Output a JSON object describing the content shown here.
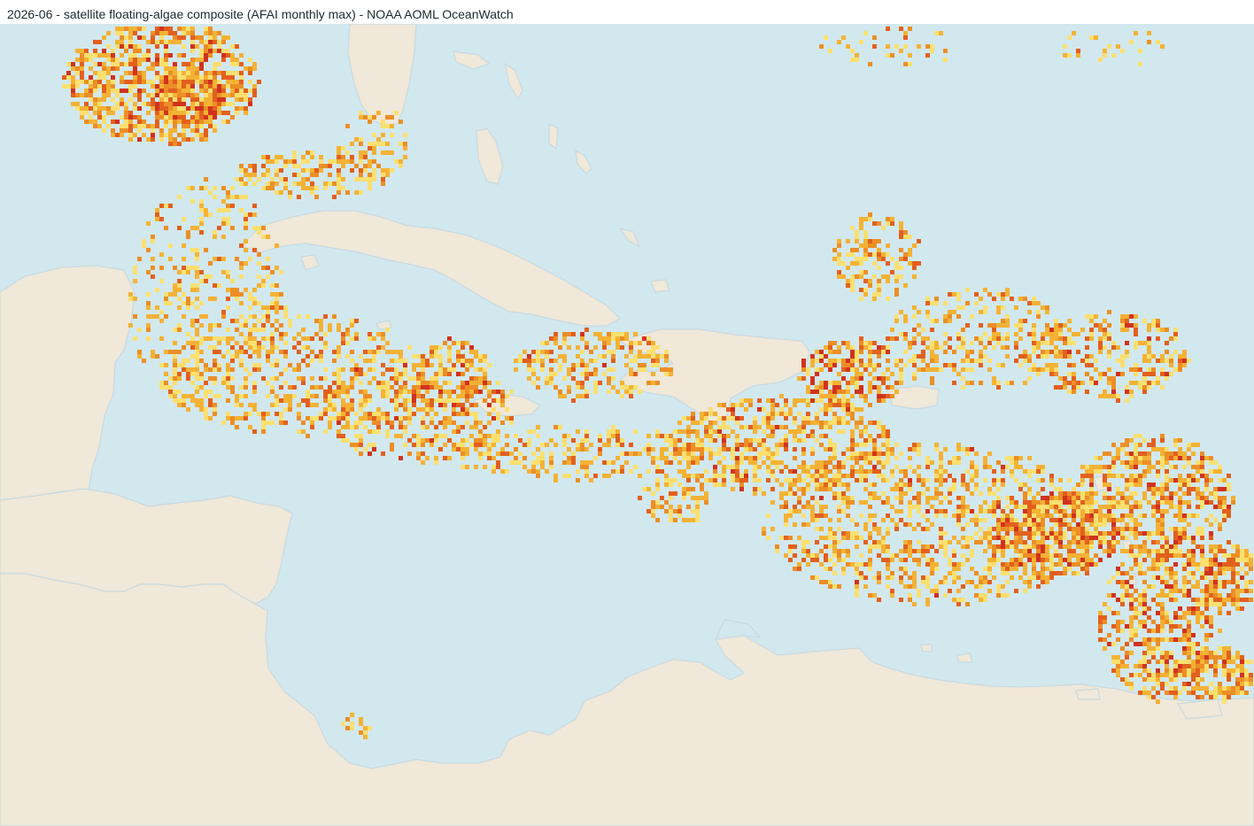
{
  "map": {
    "title": "2026-06 - satellite floating-algae composite (AFAI monthly max) - NOAA AOML OceanWatch",
    "colors": {
      "ocean": "#d2e8ef",
      "land": "#f0e8d8",
      "coast": "#c8d9e0",
      "density_low": "#fbe070",
      "density_mid": "#f4b234",
      "density_high_1": "#ec8e26",
      "density_high_2": "#e2601e",
      "density_peak": "#d1321e"
    },
    "layer": "floating-algae density",
    "legend_visible": false
  }
}
